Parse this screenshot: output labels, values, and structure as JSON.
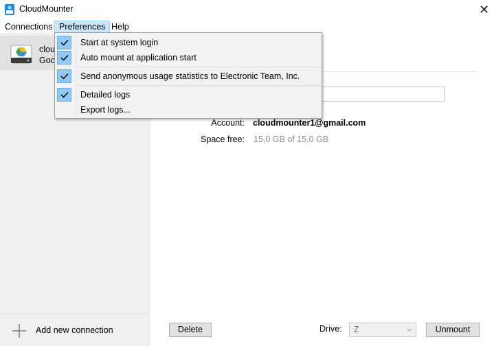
{
  "app": {
    "title": "CloudMounter",
    "close_glyph": "✕"
  },
  "menubar": {
    "items": [
      "Connections",
      "Preferences",
      "Help"
    ],
    "active": "Preferences"
  },
  "preferences_menu": {
    "items": [
      {
        "label": "Start at system login",
        "checked": true
      },
      {
        "label": "Auto mount at application start",
        "checked": true
      },
      {
        "label": "Send anonymous usage statistics to Electronic Team, Inc.",
        "checked": true
      },
      {
        "label": "Detailed logs",
        "checked": true
      },
      {
        "label": "Export logs...",
        "checked": false
      }
    ]
  },
  "sidebar": {
    "connection": {
      "name": "clou",
      "subtitle": "Goo",
      "icon": "google-drive-disk-icon"
    },
    "add_label": "Add new connection"
  },
  "details": {
    "account_label": "Account:",
    "account_value": "cloudmounter1@gmail.com",
    "space_label": "Space free:",
    "space_value": "15,0 GB of 15,0 GB"
  },
  "footer": {
    "delete_label": "Delete",
    "drive_label": "Drive:",
    "drive_value": "Z",
    "unmount_label": "Unmount"
  },
  "colors": {
    "sidebar_bg": "#f0f0f0",
    "menu_highlight": "#cce8ff",
    "check_bg": "#90c8f6",
    "button_bg": "#e1e1e1"
  }
}
